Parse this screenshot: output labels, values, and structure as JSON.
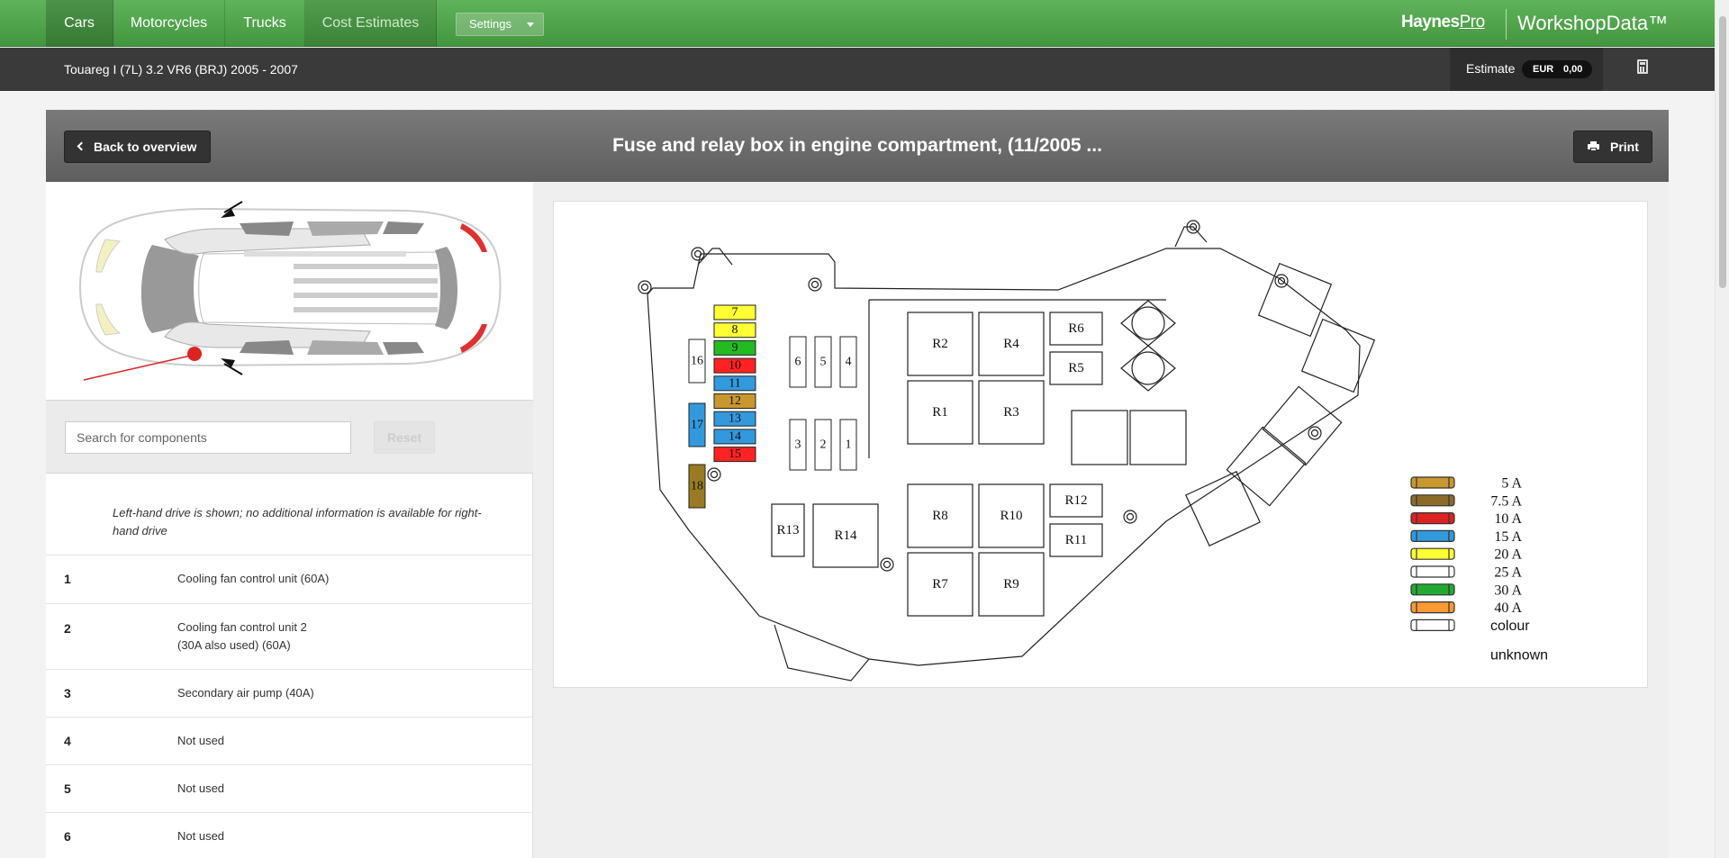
{
  "nav": {
    "tabs": [
      {
        "label": "Cars"
      },
      {
        "label": "Motorcycles"
      },
      {
        "label": "Trucks"
      },
      {
        "label": "Cost Estimates"
      }
    ],
    "settings_label": "Settings",
    "brand_haynes": "Haynes",
    "brand_pro": "Pro",
    "brand_workshop": "WorkshopData™"
  },
  "subbar": {
    "vehicle": "Touareg I (7L) 3.2 VR6 (BRJ) 2005 - 2007",
    "estimate_label": "Estimate",
    "currency": "EUR",
    "estimate_value": "0,00"
  },
  "titlebar": {
    "back_label": "Back to overview",
    "title": "Fuse and relay box in engine compartment, (11/2005 ...",
    "print_label": "Print"
  },
  "sidebar": {
    "search_placeholder": "Search for components",
    "reset_label": "Reset",
    "note": "Left-hand drive is shown; no additional information is available for right-hand drive",
    "items": [
      {
        "num": "1",
        "line1": "Cooling fan control unit (60A)",
        "line2": ""
      },
      {
        "num": "2",
        "line1": "Cooling fan control unit 2",
        "line2": "(30A also used) (60A)"
      },
      {
        "num": "3",
        "line1": "Secondary air pump (40A)",
        "line2": ""
      },
      {
        "num": "4",
        "line1": "Not used",
        "line2": ""
      },
      {
        "num": "5",
        "line1": "Not used",
        "line2": ""
      },
      {
        "num": "6",
        "line1": "Not used",
        "line2": ""
      }
    ]
  },
  "diagram": {
    "fuses": [
      {
        "label": "7",
        "color": "#ffff33"
      },
      {
        "label": "8",
        "color": "#ffff33"
      },
      {
        "label": "9",
        "color": "#22bb22"
      },
      {
        "label": "10",
        "color": "#ff2222"
      },
      {
        "label": "11",
        "color": "#3399dd"
      },
      {
        "label": "12",
        "color": "#c8982e"
      },
      {
        "label": "13",
        "color": "#3399dd"
      },
      {
        "label": "14",
        "color": "#3399dd"
      },
      {
        "label": "15",
        "color": "#ff2222"
      }
    ],
    "side_fuses": [
      {
        "label": "16",
        "color": "#ffffff"
      },
      {
        "label": "17",
        "color": "#3399dd"
      },
      {
        "label": "18",
        "color": "#9a7a22"
      }
    ],
    "small_fuses_top": [
      "6",
      "5",
      "4"
    ],
    "small_fuses_bottom": [
      "3",
      "2",
      "1"
    ],
    "relays": [
      "R2",
      "R4",
      "R6",
      "R5",
      "R1",
      "R3",
      "R8",
      "R10",
      "R12",
      "R11",
      "R7",
      "R9",
      "R13",
      "R14"
    ],
    "legend": [
      {
        "label": "5 A",
        "color": "#c8982e"
      },
      {
        "label": "7.5 A",
        "color": "#8b6a2a"
      },
      {
        "label": "10 A",
        "color": "#dd2222"
      },
      {
        "label": "15 A",
        "color": "#3399dd"
      },
      {
        "label": "20 A",
        "color": "#ffff33"
      },
      {
        "label": "25 A",
        "color": "#ffffff"
      },
      {
        "label": "30 A",
        "color": "#22aa33"
      },
      {
        "label": "40 A",
        "color": "#ff9933"
      },
      {
        "label": "colour",
        "color": "#ffffff"
      }
    ],
    "legend_unknown": "unknown"
  }
}
